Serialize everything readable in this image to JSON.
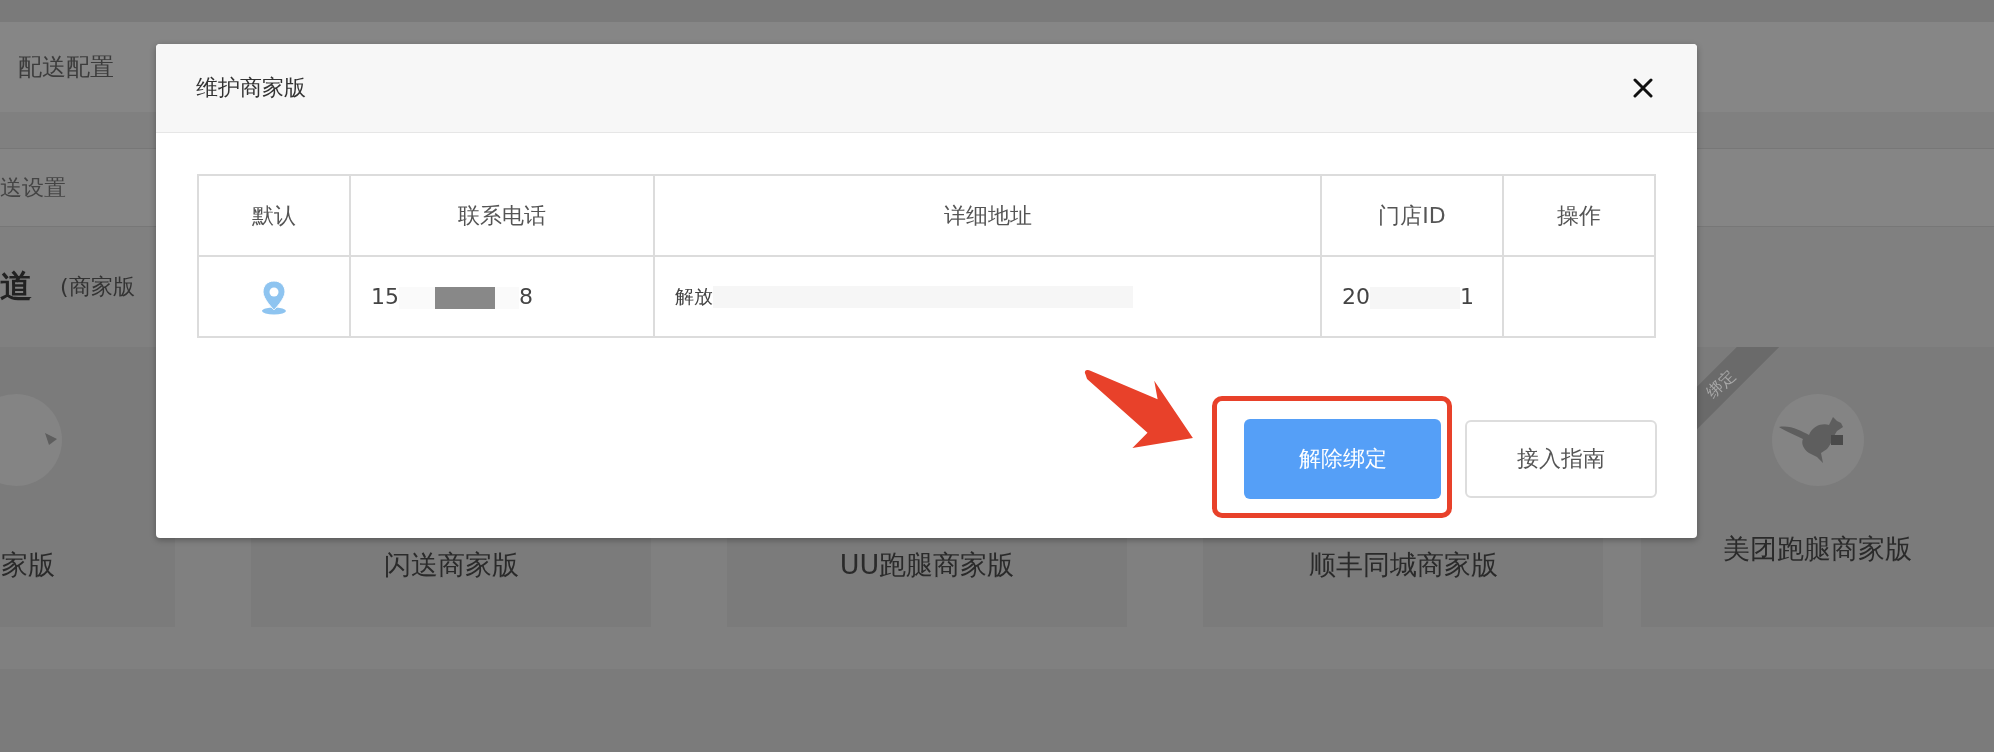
{
  "page": {
    "top_bar": "配送配置",
    "sub_bar": "送设置",
    "section_title": "道",
    "section_note": "(商家版",
    "cards": [
      {
        "label": "家版",
        "kind": "icon"
      },
      {
        "label": "闪送商家版",
        "kind": "plain"
      },
      {
        "label": "UU跑腿商家版",
        "kind": "plain"
      },
      {
        "label": "顺丰同城商家版",
        "kind": "plain"
      },
      {
        "label": "美团跑腿商家版",
        "kind": "icon",
        "ribbon": "绑定"
      }
    ]
  },
  "dialog": {
    "title": "维护商家版",
    "table": {
      "columns": [
        "默认",
        "联系电话",
        "详细地址",
        "门店ID",
        "操作"
      ],
      "rows": [
        {
          "default": true,
          "phone_start": "15",
          "phone_end": "8",
          "address": "解放",
          "store_id_start": "20",
          "store_id_end": "1"
        }
      ]
    },
    "buttons": [
      {
        "label": "解除绑定",
        "kind": "primary",
        "highlighted": true
      },
      {
        "label": "接入指南",
        "kind": "default",
        "highlighted": false
      }
    ]
  }
}
